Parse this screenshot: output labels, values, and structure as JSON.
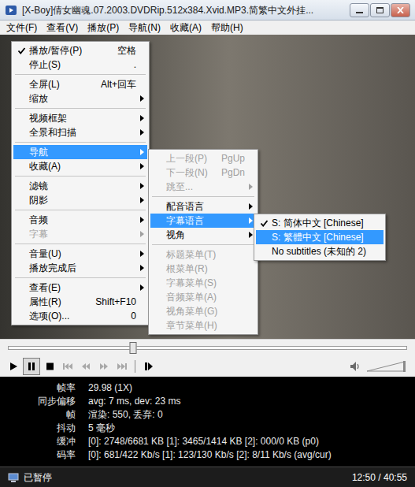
{
  "window": {
    "title": "[X-Boy]倩女幽魂.07.2003.DVDRip.512x384.Xvid.MP3.简繁中文外挂..."
  },
  "menubar": [
    "文件(F)",
    "查看(V)",
    "播放(P)",
    "导航(N)",
    "收藏(A)",
    "帮助(H)"
  ],
  "context_menu": {
    "groups": [
      [
        {
          "label": "播放/暂停(P)",
          "shortcut": "空格",
          "checked": true,
          "submenu": false,
          "disabled": false,
          "selected": false
        },
        {
          "label": "停止(S)",
          "shortcut": ".",
          "checked": false,
          "submenu": false,
          "disabled": false,
          "selected": false
        }
      ],
      [
        {
          "label": "全屏(L)",
          "shortcut": "Alt+回车",
          "checked": false,
          "submenu": false,
          "disabled": false,
          "selected": false
        },
        {
          "label": "缩放",
          "checked": false,
          "submenu": true,
          "disabled": false,
          "selected": false
        }
      ],
      [
        {
          "label": "视频框架",
          "checked": false,
          "submenu": true,
          "disabled": false,
          "selected": false
        },
        {
          "label": "全景和扫描",
          "checked": false,
          "submenu": true,
          "disabled": false,
          "selected": false
        }
      ],
      [
        {
          "label": "导航",
          "checked": false,
          "submenu": true,
          "disabled": false,
          "selected": true
        },
        {
          "label": "收藏(A)",
          "checked": false,
          "submenu": true,
          "disabled": false,
          "selected": false
        }
      ],
      [
        {
          "label": "滤镜",
          "checked": false,
          "submenu": true,
          "disabled": false,
          "selected": false
        },
        {
          "label": "阴影",
          "checked": false,
          "submenu": true,
          "disabled": false,
          "selected": false
        }
      ],
      [
        {
          "label": "音频",
          "checked": false,
          "submenu": true,
          "disabled": false,
          "selected": false
        },
        {
          "label": "字幕",
          "checked": false,
          "submenu": true,
          "disabled": true,
          "selected": false
        }
      ],
      [
        {
          "label": "音量(U)",
          "checked": false,
          "submenu": true,
          "disabled": false,
          "selected": false
        },
        {
          "label": "播放完成后",
          "checked": false,
          "submenu": true,
          "disabled": false,
          "selected": false
        }
      ],
      [
        {
          "label": "查看(E)",
          "checked": false,
          "submenu": true,
          "disabled": false,
          "selected": false
        },
        {
          "label": "属性(R)",
          "shortcut": "Shift+F10",
          "checked": false,
          "submenu": false,
          "disabled": false,
          "selected": false
        },
        {
          "label": "选项(O)...",
          "shortcut": "0",
          "checked": false,
          "submenu": false,
          "disabled": false,
          "selected": false
        }
      ]
    ]
  },
  "navigation_submenu": {
    "groups": [
      [
        {
          "label": "上一段(P)",
          "shortcut": "PgUp",
          "checked": false,
          "submenu": false,
          "disabled": true,
          "selected": false
        },
        {
          "label": "下一段(N)",
          "shortcut": "PgDn",
          "checked": false,
          "submenu": false,
          "disabled": true,
          "selected": false
        },
        {
          "label": "跳至...",
          "checked": false,
          "submenu": true,
          "disabled": true,
          "selected": false
        }
      ],
      [
        {
          "label": "配音语言",
          "checked": false,
          "submenu": true,
          "disabled": false,
          "selected": false
        },
        {
          "label": "字幕语言",
          "checked": false,
          "submenu": true,
          "disabled": false,
          "selected": true
        },
        {
          "label": "视角",
          "checked": false,
          "submenu": true,
          "disabled": false,
          "selected": false
        }
      ],
      [
        {
          "label": "标题菜单(T)",
          "checked": false,
          "submenu": false,
          "disabled": true,
          "selected": false
        },
        {
          "label": "根菜单(R)",
          "checked": false,
          "submenu": false,
          "disabled": true,
          "selected": false
        },
        {
          "label": "字幕菜单(S)",
          "checked": false,
          "submenu": false,
          "disabled": true,
          "selected": false
        },
        {
          "label": "音频菜单(A)",
          "checked": false,
          "submenu": false,
          "disabled": true,
          "selected": false
        },
        {
          "label": "视角菜单(G)",
          "checked": false,
          "submenu": false,
          "disabled": true,
          "selected": false
        },
        {
          "label": "章节菜单(H)",
          "checked": false,
          "submenu": false,
          "disabled": true,
          "selected": false
        }
      ]
    ]
  },
  "subtitle_language_submenu": {
    "groups": [
      [
        {
          "label": "S: 简体中文 [Chinese]",
          "checked": true,
          "submenu": false,
          "disabled": false,
          "selected": false
        },
        {
          "label": "S: 繁體中文 [Chinese]",
          "checked": false,
          "submenu": false,
          "disabled": false,
          "selected": true
        },
        {
          "label": "No subtitles (未知的 2)",
          "checked": false,
          "submenu": false,
          "disabled": false,
          "selected": false
        }
      ]
    ]
  },
  "seek_bar": {
    "level": 0.313
  },
  "controls": [
    [
      {
        "kind": "play",
        "selected": false,
        "disabled": false
      },
      {
        "kind": "pause",
        "selected": true,
        "disabled": false
      },
      {
        "kind": "stop",
        "selected": false,
        "disabled": false
      },
      {
        "kind": "previous",
        "selected": false,
        "disabled": true
      },
      {
        "kind": "rewind",
        "selected": false,
        "disabled": true
      },
      {
        "kind": "forward",
        "selected": false,
        "disabled": true
      },
      {
        "kind": "next",
        "selected": false,
        "disabled": true
      }
    ],
    [
      {
        "kind": "frame-step",
        "selected": false,
        "disabled": false
      }
    ]
  ],
  "volume": {
    "level": 1
  },
  "stats": [
    {
      "label": "帧率",
      "value": "29.98 (1X)"
    },
    {
      "label": "同步偏移",
      "value": "avg: 7 ms, dev: 23 ms"
    },
    {
      "label": "帧",
      "value": "渲染: 550, 丢弃: 0"
    },
    {
      "label": "抖动",
      "value": "5 毫秒"
    },
    {
      "label": "缓冲",
      "value": "[0]: 2748/6681 KB [1]: 3465/1414 KB [2]: 000/0 KB (p0)"
    },
    {
      "label": "码率",
      "value": "[0]: 681/422 Kb/s [1]: 123/130 Kb/s [2]: 8/11 Kb/s (avg/cur)"
    }
  ],
  "status_bar": {
    "state": "已暂停",
    "time": "12:50 / 40:55"
  }
}
